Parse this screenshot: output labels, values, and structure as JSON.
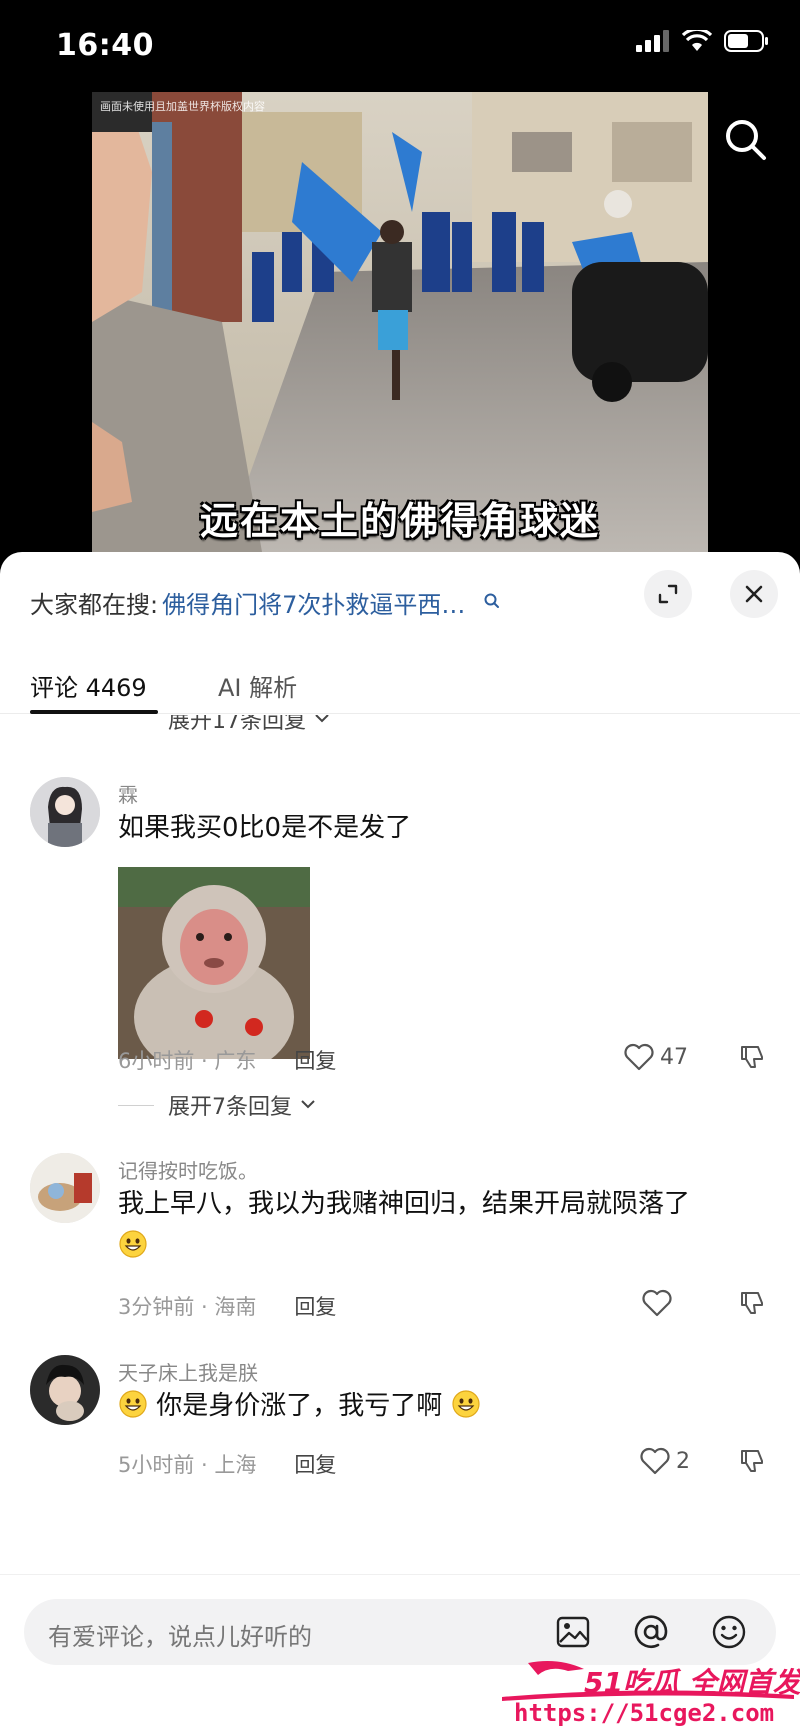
{
  "status_bar": {
    "time": "16:40"
  },
  "video": {
    "watermark": "画面未使用且加盖世界杯版权内容",
    "caption": "远在本土的佛得角球迷"
  },
  "search": {
    "prefix": "大家都在搜:",
    "query": "佛得角门将7次扑救逼平西…"
  },
  "tabs": [
    {
      "label": "评论 4469",
      "active": true
    },
    {
      "label": "AI 解析",
      "active": false
    }
  ],
  "expand_top": "展开17条回复",
  "comments": [
    {
      "username": "霖",
      "text": "如果我买0比0是不是发了",
      "time_location": "6小时前 · 广东",
      "reply_label": "回复",
      "likes": "47",
      "has_image": true,
      "expand_replies": "展开7条回复"
    },
    {
      "username": "记得按时吃饭。",
      "text": "我上早八，我以为我赌神回归，结果开局就陨落了",
      "time_location": "3分钟前 · 海南",
      "reply_label": "回复",
      "likes": ""
    },
    {
      "username": "天子床上我是朕",
      "text": "你是身价涨了，我亏了啊",
      "time_location": "5小时前 · 上海",
      "reply_label": "回复",
      "likes": "2"
    }
  ],
  "input": {
    "placeholder": "有爱评论，说点儿好听的"
  },
  "promo": {
    "title": "51吃瓜 全网首发",
    "url": "https://51cge2.com"
  },
  "colors": {
    "link": "#2c5e9e",
    "promo": "#e8175d",
    "panel_bg": "#ffffff"
  },
  "icons": [
    "search-icon",
    "expand-icon",
    "close-icon",
    "heart-icon",
    "dislike-icon",
    "image-icon",
    "at-icon",
    "emoji-icon"
  ]
}
